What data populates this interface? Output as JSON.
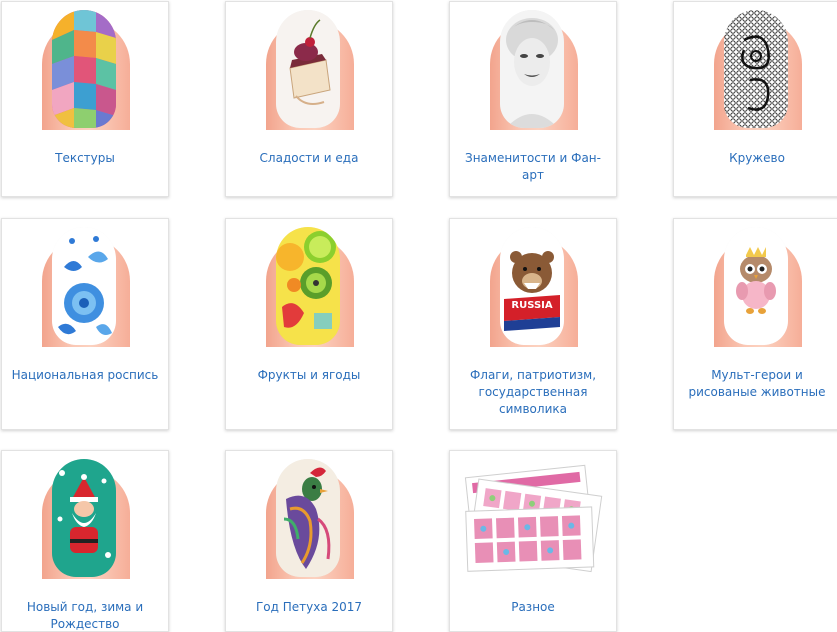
{
  "categories": [
    {
      "label": "Текстуры",
      "icon": "hexagon-pattern-nail-icon"
    },
    {
      "label": "Сладости и еда",
      "icon": "dessert-nail-icon"
    },
    {
      "label": "Знаменитости и Фан-арт",
      "icon": "celebrity-portrait-nail-icon"
    },
    {
      "label": "Кружево",
      "icon": "lace-nail-icon"
    },
    {
      "label": "Национальная роспись",
      "icon": "folk-painting-nail-icon"
    },
    {
      "label": "Фрукты и ягоды",
      "icon": "fruit-nail-icon"
    },
    {
      "label": "Флаги, патриотизм, государственная символика",
      "icon": "russia-bear-nail-icon",
      "badge": "RUSSIA"
    },
    {
      "label": "Мульт-герои и рисованые животные",
      "icon": "cartoon-owl-nail-icon"
    },
    {
      "label": "Новый год, зима и Рождество",
      "icon": "santa-nail-icon"
    },
    {
      "label": "Год Петуха 2017",
      "icon": "rooster-nail-icon"
    },
    {
      "label": "Разное",
      "icon": "sticker-sheets-icon"
    }
  ],
  "colors": {
    "link": "#2a6ebb",
    "card_border": "#e2e2e2",
    "skin": "#f8bca8"
  }
}
